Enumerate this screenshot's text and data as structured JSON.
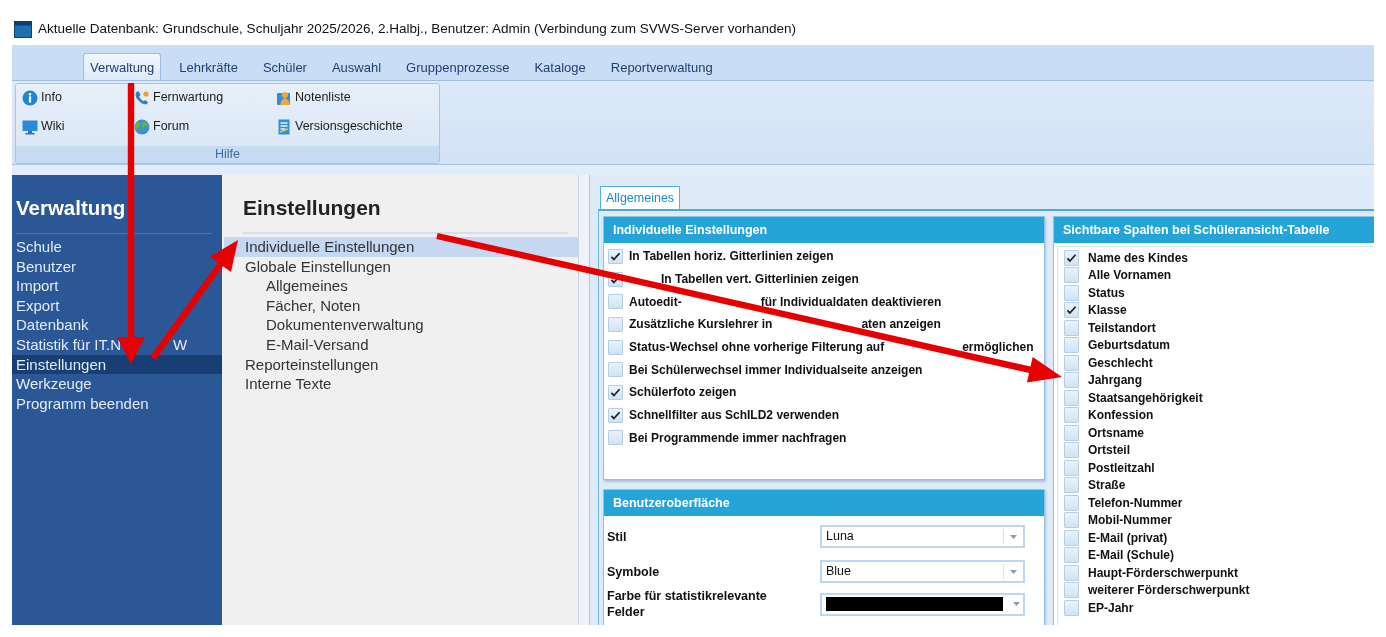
{
  "window": {
    "title": "Aktuelle Datenbank: Grundschule, Schuljahr 2025/2026, 2.Halbj., Benutzer: Admin (Verbindung zum SVWS-Server vorhanden)"
  },
  "ribbon": {
    "tabs": [
      {
        "label": "Verwaltung",
        "selected": true
      },
      {
        "label": "Lehrkräfte",
        "selected": false
      },
      {
        "label": "Schüler",
        "selected": false
      },
      {
        "label": "Auswahl",
        "selected": false
      },
      {
        "label": "Gruppenprozesse",
        "selected": false
      },
      {
        "label": "Kataloge",
        "selected": false
      },
      {
        "label": "Reportverwaltung",
        "selected": false
      }
    ],
    "groups": [
      {
        "label": "Hilfe",
        "items": [
          {
            "label": "Info"
          },
          {
            "label": "Fernwartung"
          },
          {
            "label": "Notenliste"
          },
          {
            "label": "Wiki"
          },
          {
            "label": "Forum"
          },
          {
            "label": "Versionsgeschichte"
          }
        ]
      }
    ]
  },
  "sidebar": {
    "title": "Verwaltung",
    "items": [
      {
        "label": "Schule",
        "selected": false
      },
      {
        "label": "Benutzer",
        "selected": false
      },
      {
        "label": "Import",
        "selected": false
      },
      {
        "label": "Export",
        "selected": false
      },
      {
        "label": "Datenbank",
        "selected": false
      },
      {
        "label_parts": [
          "Statistik für IT.N",
          "W"
        ],
        "selected": false
      },
      {
        "label": "Einstellungen",
        "selected": true
      },
      {
        "label": "Werkzeuge",
        "selected": false
      },
      {
        "label": "Programm beenden",
        "selected": false
      }
    ]
  },
  "settings_nav": {
    "title": "Einstellungen",
    "items": [
      {
        "label": "Individuelle Einstellungen",
        "selected": true
      },
      {
        "label": "Globale Einstellungen",
        "selected": false,
        "children": [
          {
            "label": "Allgemeines",
            "selected": false
          },
          {
            "label": "Fächer, Noten",
            "selected": false
          },
          {
            "label": "Dokumentenverwaltung",
            "selected": false
          },
          {
            "label": "E-Mail-Versand",
            "selected": false
          }
        ]
      },
      {
        "label": "Reporteinstellungen",
        "selected": false
      },
      {
        "label": "Interne Texte",
        "selected": false
      }
    ]
  },
  "content": {
    "tabs": [
      {
        "label": "Allgemeines",
        "selected": true
      }
    ],
    "individual_settings": {
      "title": "Individuelle Einstellungen",
      "options": [
        {
          "label": "In Tabellen horiz. Gitterlinien zeigen",
          "checked": true
        },
        {
          "label": "In Tabellen vert. Gitterlinien zeigen",
          "checked": true
        },
        {
          "label_parts": [
            "Autoedit-",
            "für Individualdaten deaktivieren"
          ],
          "checked": false
        },
        {
          "label_parts": [
            "Zusätzliche Kurslehrer in",
            "aten anzeigen"
          ],
          "checked": false
        },
        {
          "label_parts": [
            "Status-Wechsel ohne vorherige Filterung auf",
            "ermöglichen"
          ],
          "checked": false
        },
        {
          "label": "Bei Schülerwechsel immer Individualseite anzeigen",
          "checked": false
        },
        {
          "label": "Schülerfoto zeigen",
          "checked": true
        },
        {
          "label": "Schnellfilter aus SchILD2 verwenden",
          "checked": true
        },
        {
          "label": "Bei Programmende immer nachfragen",
          "checked": false
        }
      ]
    },
    "user_interface": {
      "title": "Benutzeroberfläche",
      "fields": [
        {
          "kind": "select",
          "label": "Stil",
          "value": "Luna"
        },
        {
          "kind": "select",
          "label": "Symbole",
          "value": "Blue"
        },
        {
          "kind": "color",
          "label": "Farbe für statistikrelevante Felder",
          "color": "#000000"
        }
      ]
    },
    "visible_columns": {
      "title": "Sichtbare Spalten bei Schüleransicht-Tabelle",
      "columns": [
        {
          "label": "Name des Kindes",
          "checked": true
        },
        {
          "label": "Alle Vornamen",
          "checked": false
        },
        {
          "label": "Status",
          "checked": false
        },
        {
          "label": "Klasse",
          "checked": true
        },
        {
          "label": "Teilstandort",
          "checked": false
        },
        {
          "label": "Geburtsdatum",
          "checked": false
        },
        {
          "label": "Geschlecht",
          "checked": false
        },
        {
          "label": "Jahrgang",
          "checked": false
        },
        {
          "label": "Staatsangehörigkeit",
          "checked": false
        },
        {
          "label": "Konfession",
          "checked": false
        },
        {
          "label": "Ortsname",
          "checked": false
        },
        {
          "label": "Ortsteil",
          "checked": false
        },
        {
          "label": "Postleitzahl",
          "checked": false
        },
        {
          "label": "Straße",
          "checked": false
        },
        {
          "label": "Telefon-Nummer",
          "checked": false
        },
        {
          "label": "Mobil-Nummer",
          "checked": false
        },
        {
          "label": "E-Mail (privat)",
          "checked": false
        },
        {
          "label": "E-Mail (Schule)",
          "checked": false
        },
        {
          "label": "Haupt-Förderschwerpunkt",
          "checked": false
        },
        {
          "label": "weiterer Förderschwerpunkt",
          "checked": false
        },
        {
          "label": "EP-Jahr",
          "checked": false
        }
      ]
    }
  }
}
